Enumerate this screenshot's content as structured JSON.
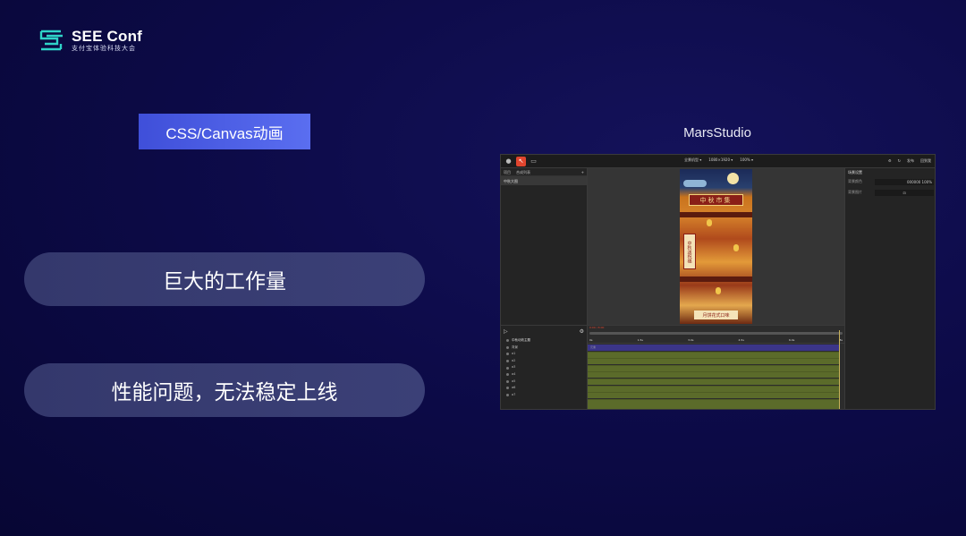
{
  "logo": {
    "title": "SEE Conf",
    "subtitle": "支付宝体验科技大会",
    "accent": "#2fd3c8"
  },
  "section_tag": "CSS/Canvas动画",
  "points": [
    {
      "text": "巨大的工作量"
    },
    {
      "text": "性能问题，无法稳定上线"
    }
  ],
  "app": {
    "title": "MarsStudio",
    "topbar": {
      "center": [
        "全景机型 ▾",
        "1080×1920 ▾",
        "100% ▾"
      ],
      "right": [
        "⚙",
        "↻",
        "发布",
        "回到我"
      ]
    },
    "left_panel": {
      "tabs": [
        "项目",
        "合成列表"
      ],
      "add": "+",
      "item": "中秋大图"
    },
    "poster": {
      "banner": "中秋市集",
      "side": "中秋送祝福",
      "foot": "月饼花式口味"
    },
    "right_panel": {
      "title": "场景设置",
      "rows": [
        {
          "label": "背景颜色",
          "value": "000000 100%"
        },
        {
          "label": "背景图片",
          "value": "⊡"
        }
      ]
    },
    "timeline": {
      "play": "▷",
      "settings": "⚙",
      "time": "0:00 / 8:00",
      "ruler": [
        "0s",
        "1.5s",
        "3.0s",
        "4.5s",
        "6.0s",
        "8s"
      ],
      "layers": [
        "中秋动效主题",
        "背景",
        "a1",
        "a2",
        "a3",
        "a4",
        "a5",
        "a6",
        "a7"
      ],
      "track_label": "元素"
    }
  }
}
